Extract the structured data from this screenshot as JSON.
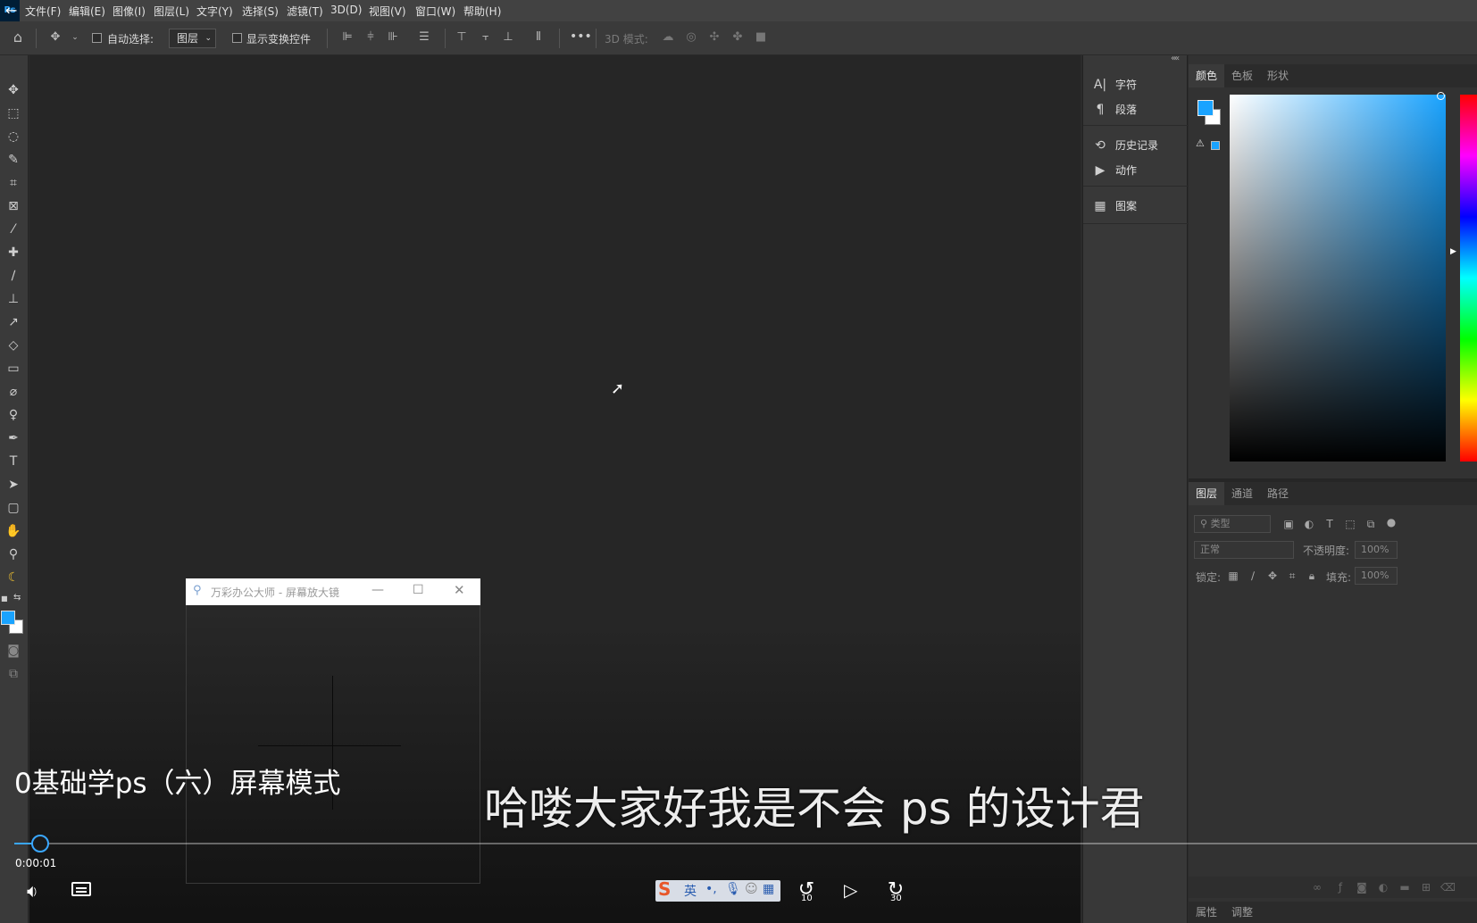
{
  "menubar": {
    "logo": "Ps",
    "items": [
      "文件(F)",
      "编辑(E)",
      "图像(I)",
      "图层(L)",
      "文字(Y)",
      "选择(S)",
      "滤镜(T)",
      "3D(D)",
      "视图(V)",
      "窗口(W)",
      "帮助(H)"
    ]
  },
  "options": {
    "auto_select_label": "自动选择:",
    "layer_select_value": "图层",
    "show_transform_label": "显示变换控件",
    "more_label": "•••",
    "mode_3d_label": "3D 模式:"
  },
  "mini_panel": {
    "items": [
      {
        "label": "字符",
        "icon": "A|"
      },
      {
        "label": "段落",
        "icon": "¶"
      },
      {
        "label": "历史记录",
        "icon": "⟲"
      },
      {
        "label": "动作",
        "icon": "▶"
      },
      {
        "label": "图案",
        "icon": "▦"
      }
    ]
  },
  "color_panel": {
    "tabs": [
      "颜色",
      "色板",
      "形状"
    ],
    "foreground": "#1aa3ff",
    "background": "#ffffff"
  },
  "layers_panel": {
    "tabs": [
      "图层",
      "通道",
      "路径"
    ],
    "filter_placeholder": "类型",
    "blend_mode": "正常",
    "opacity_label": "不透明度:",
    "opacity_value": "100%",
    "lock_label": "锁定:",
    "fill_label": "填充:",
    "fill_value": "100%",
    "bottom_tabs": [
      "属性",
      "调整"
    ]
  },
  "magnifier": {
    "title": "万彩办公大师 - 屏幕放大镜"
  },
  "video": {
    "title": "0基础学ps（六）屏幕模式",
    "subtitle": "哈喽大家好我是不会 ps 的设计君",
    "time": "0:00:01",
    "progress": 0.018,
    "rewind_label": "10",
    "forward_label": "30",
    "ime_label": "英"
  }
}
